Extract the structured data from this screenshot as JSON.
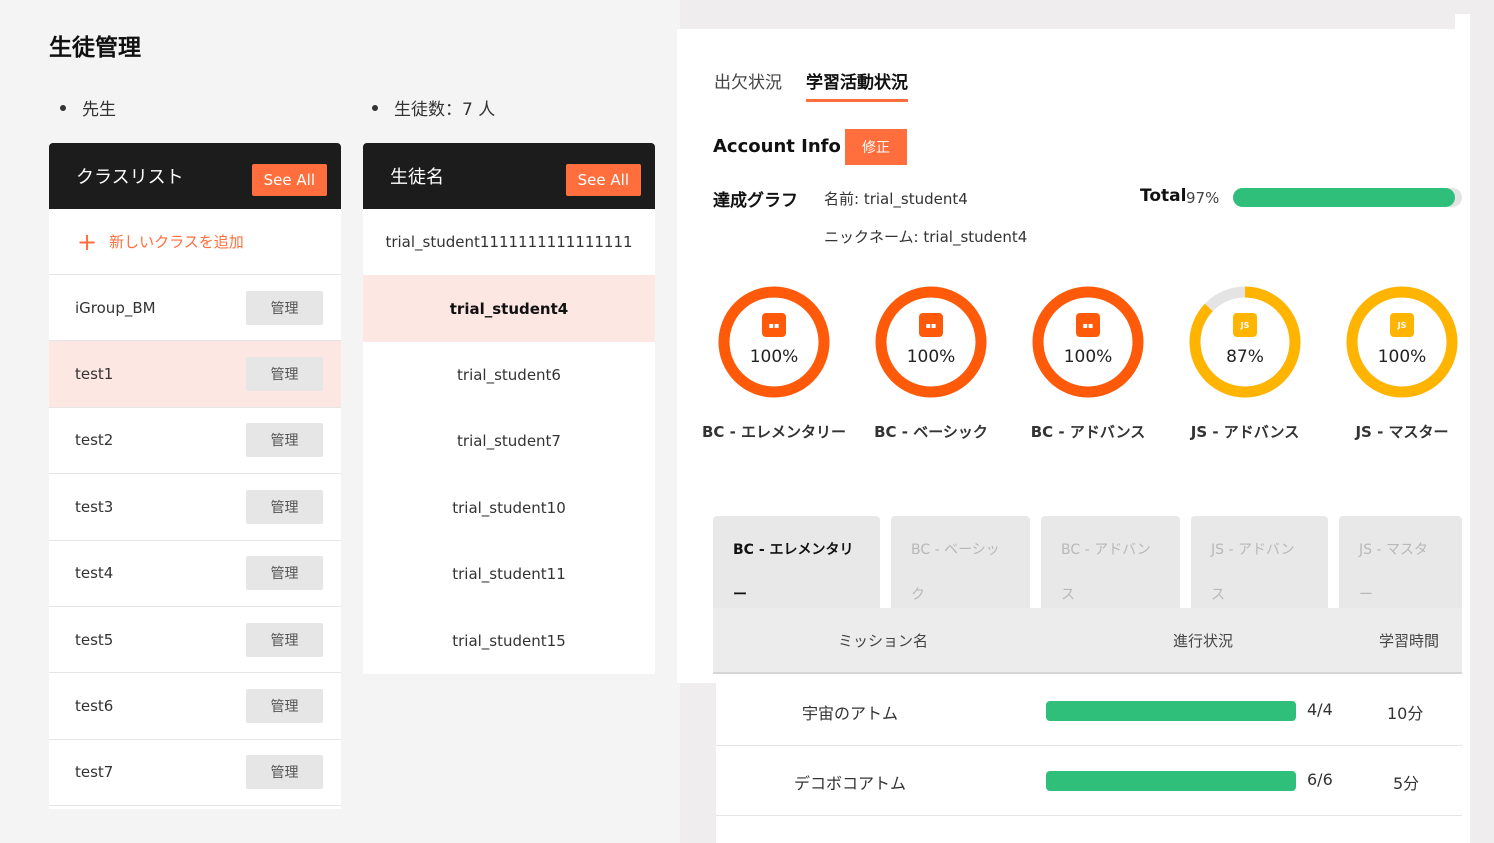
{
  "page_title": "生徒管理",
  "teacher_label": "先生",
  "student_count_label": "生徒数：7 人",
  "class_list": {
    "header": "クラスリスト",
    "see_all": "See All",
    "add_label": "新しいクラスを追加",
    "manage_label": "管理",
    "items": [
      "iGroup_BM",
      "test1",
      "test2",
      "test3",
      "test4",
      "test5",
      "test6",
      "test7"
    ],
    "selected": "test1"
  },
  "student_list": {
    "header": "生徒名",
    "see_all": "See All",
    "items": [
      "trial_student1111111111111111",
      "trial_student4",
      "trial_student6",
      "trial_student7",
      "trial_student10",
      "trial_student11",
      "trial_student15"
    ],
    "selected": "trial_student4"
  },
  "tabs": [
    "出欠状況",
    "学習活動状況"
  ],
  "active_tab": "学習活動状況",
  "account": {
    "title": "Account Info",
    "edit": "修正",
    "graph_title": "達成グラフ",
    "name_line": "名前: trial_student4",
    "nickname_line": "ニックネーム: trial_student4",
    "total_label": "Total",
    "total_pct_text": "97%",
    "total_fraction": 0.97
  },
  "courses": [
    {
      "label": "BC - エレメンタリー",
      "pct_text": "100%",
      "fraction": 1.0,
      "color": "#ff5a0a",
      "icon": "block-icon"
    },
    {
      "label": "BC - ベーシック",
      "pct_text": "100%",
      "fraction": 1.0,
      "color": "#ff5a0a",
      "icon": "block-icon"
    },
    {
      "label": "BC - アドバンス",
      "pct_text": "100%",
      "fraction": 1.0,
      "color": "#ff5a0a",
      "icon": "block-icon"
    },
    {
      "label": "JS - アドバンス",
      "pct_text": "87%",
      "fraction": 0.87,
      "color": "#ffb400",
      "icon": "js-icon"
    },
    {
      "label": "JS - マスター",
      "pct_text": "100%",
      "fraction": 1.0,
      "color": "#ffb400",
      "icon": "js-icon"
    }
  ],
  "course_tabs": [
    {
      "line1": "BC - エレメンタリ",
      "line2": "ー"
    },
    {
      "line1": "BC - ベーシッ",
      "line2": "ク"
    },
    {
      "line1": "BC - アドバン",
      "line2": "ス"
    },
    {
      "line1": "JS - アドバン",
      "line2": "ス"
    },
    {
      "line1": "JS - マスタ",
      "line2": "ー"
    }
  ],
  "mission_table": {
    "headers": [
      "ミッション名",
      "進行状況",
      "学習時間"
    ],
    "rows": [
      {
        "name": "宇宙のアトム",
        "progress": "4/4",
        "fraction": 1.0,
        "time": "10分"
      },
      {
        "name": "デコボコアトム",
        "progress": "6/6",
        "fraction": 1.0,
        "time": "5分"
      }
    ]
  },
  "colors": {
    "accent": "#ff6e3c",
    "progress": "#2fbf7a",
    "bc_ring": "#ff5a0a",
    "js_ring": "#ffb400"
  }
}
